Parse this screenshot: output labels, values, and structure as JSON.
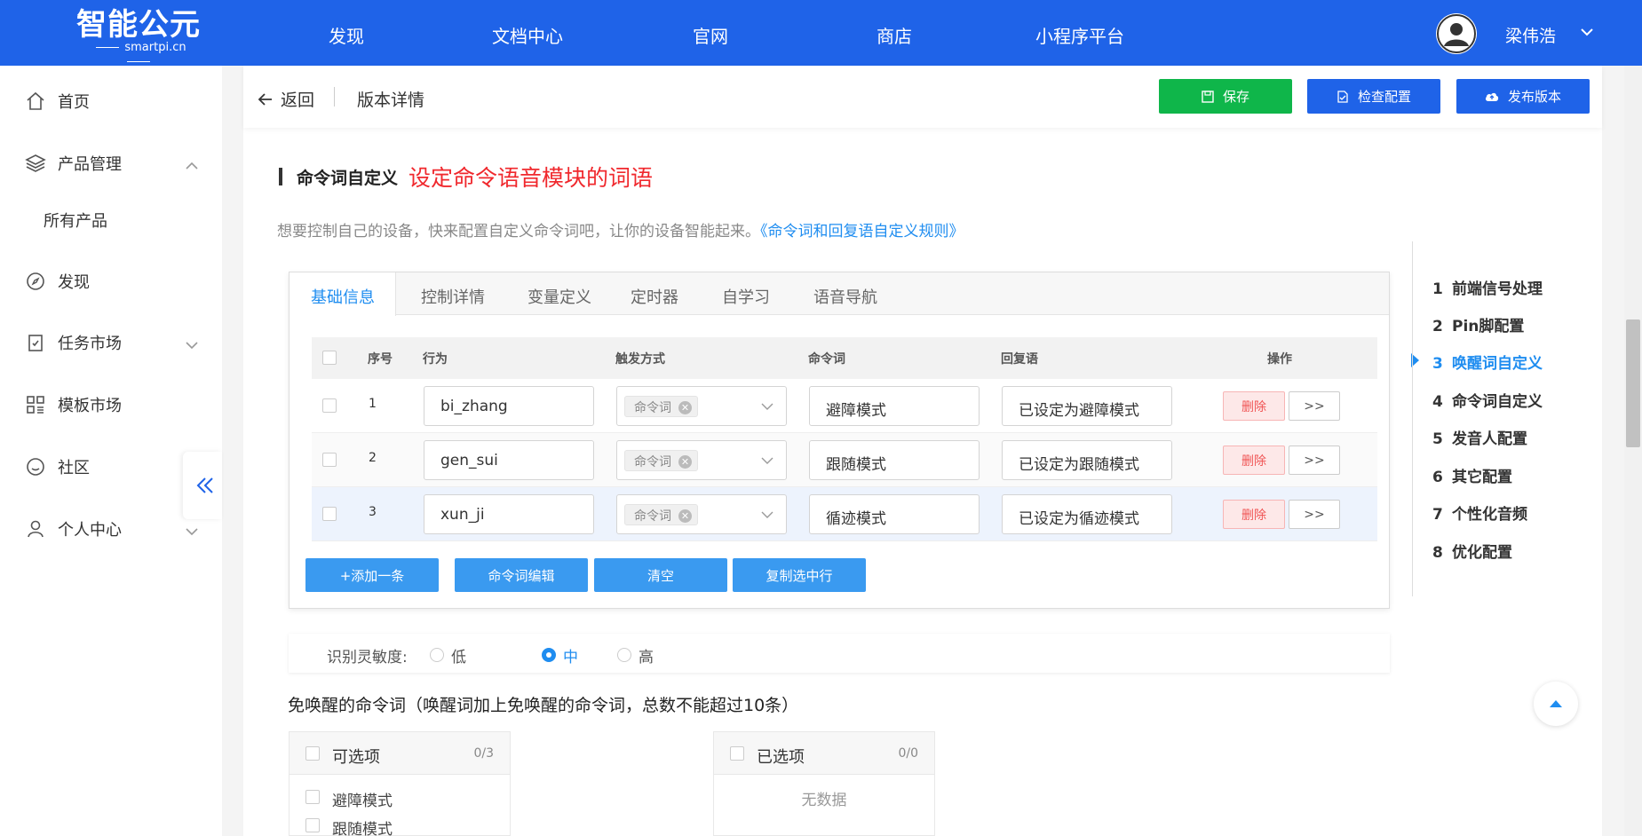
{
  "topbar": {
    "logo": {
      "name": "智能公元",
      "domain": "smartpi.cn"
    },
    "nav": [
      "发现",
      "文档中心",
      "官网",
      "商店",
      "小程序平台"
    ],
    "user_name": "梁伟浩"
  },
  "sidebar": {
    "items": [
      {
        "label": "首页",
        "icon": "home-icon"
      },
      {
        "label": "产品管理",
        "icon": "layers-icon",
        "expanded": true
      },
      {
        "label": "所有产品",
        "icon": ""
      },
      {
        "label": "发现",
        "icon": "compass-icon"
      },
      {
        "label": "任务市场",
        "icon": "task-icon",
        "expanded": false
      },
      {
        "label": "模板市场",
        "icon": "template-icon"
      },
      {
        "label": "社区",
        "icon": "community-icon"
      },
      {
        "label": "个人中心",
        "icon": "user-icon",
        "expanded": false
      }
    ]
  },
  "header": {
    "back_label": "返回",
    "breadcrumb": "版本详情",
    "buttons": {
      "save": "保存",
      "check": "检查配置",
      "publish": "发布版本"
    },
    "colors": {
      "save": "#0fb64a",
      "check": "#1f63e8",
      "publish": "#1f63e8"
    }
  },
  "section": {
    "title": "命令词自定义",
    "annotation": "设定命令语音模块的词语",
    "desc": "想要控制自己的设备，快来配置自定义命令词吧，让你的设备智能起来。",
    "desc_link": "《命令词和回复语自定义规则》"
  },
  "tabs": [
    "基础信息",
    "控制详情",
    "变量定义",
    "定时器",
    "自学习",
    "语音导航"
  ],
  "table": {
    "headers": [
      "序号",
      "行为",
      "触发方式",
      "命令词",
      "回复语",
      "操作"
    ],
    "rows": [
      {
        "index": "1",
        "action": "bi_zhang",
        "trigger": "命令词",
        "command": "避障模式",
        "reply": "已设定为避障模式",
        "delete": "删除",
        "more": ">>"
      },
      {
        "index": "2",
        "action": "gen_sui",
        "trigger": "命令词",
        "command": "跟随模式",
        "reply": "已设定为跟随模式",
        "delete": "删除",
        "more": ">>"
      },
      {
        "index": "3",
        "action": "xun_ji",
        "trigger": "命令词",
        "command": "循迹模式",
        "reply": "已设定为循迹模式",
        "delete": "删除",
        "more": ">>"
      }
    ],
    "buttons": [
      "+添加一条",
      "命令词编辑",
      "清空",
      "复制选中行"
    ]
  },
  "sensitivity": {
    "label": "识别灵敏度:",
    "options": [
      "低",
      "中",
      "高"
    ],
    "selected": "中"
  },
  "free_wake": {
    "title": "免唤醒的命令词（唤醒词加上免唤醒的命令词，总数不能超过10条）",
    "left": {
      "title": "可选项",
      "count": "0/3",
      "items": [
        "避障模式",
        "跟随模式"
      ]
    },
    "right": {
      "title": "已选项",
      "count": "0/0",
      "empty": "无数据"
    }
  },
  "steps": [
    {
      "num": "1",
      "label": "前端信号处理"
    },
    {
      "num": "2",
      "label": "Pin脚配置"
    },
    {
      "num": "3",
      "label": "唤醒词自定义",
      "active": true
    },
    {
      "num": "4",
      "label": "命令词自定义"
    },
    {
      "num": "5",
      "label": "发音人配置"
    },
    {
      "num": "6",
      "label": "其它配置"
    },
    {
      "num": "7",
      "label": "个性化音频"
    },
    {
      "num": "8",
      "label": "优化配置"
    }
  ]
}
